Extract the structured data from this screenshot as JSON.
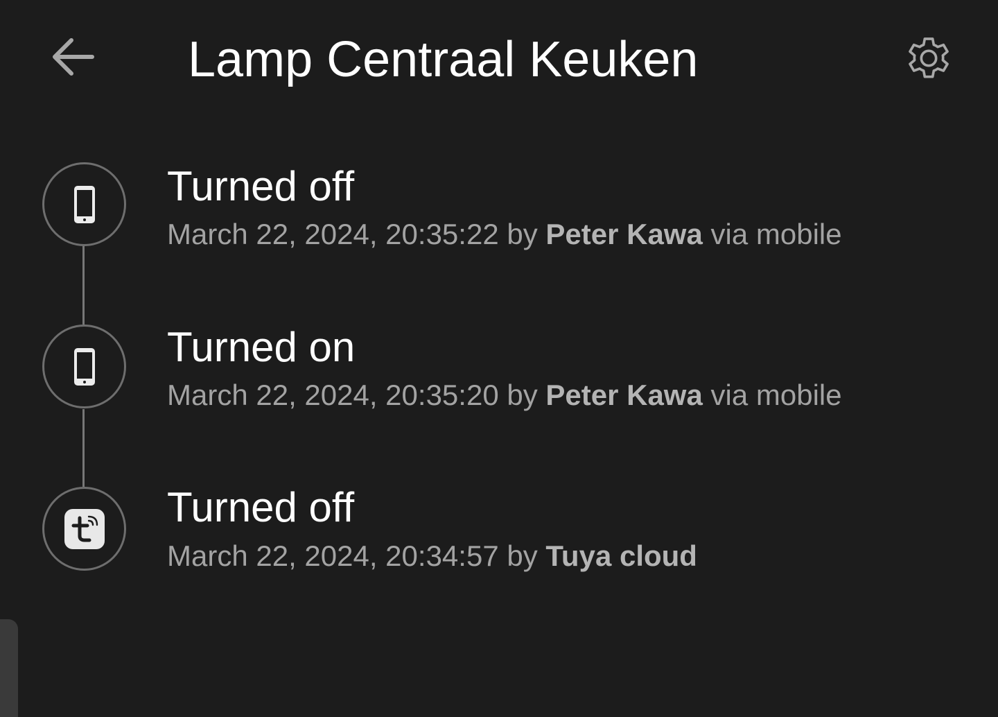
{
  "header": {
    "title": "Lamp Centraal Keuken",
    "back_icon": "arrow-left-icon",
    "settings_icon": "gear-icon"
  },
  "events": [
    {
      "title": "Turned off",
      "timestamp": "March 22, 2024, 20:35:22",
      "by_label": " by ",
      "actor": "Peter Kawa",
      "via": " via mobile",
      "source_icon": "mobile-phone-icon"
    },
    {
      "title": "Turned on",
      "timestamp": "March 22, 2024, 20:35:20",
      "by_label": " by ",
      "actor": "Peter Kawa",
      "via": " via mobile",
      "source_icon": "mobile-phone-icon"
    },
    {
      "title": "Turned off",
      "timestamp": "March 22, 2024, 20:34:57",
      "by_label": " by ",
      "actor": "Tuya cloud",
      "via": "",
      "source_icon": "tuya-app-icon"
    }
  ],
  "colors": {
    "background": "#1c1c1c",
    "title_text": "#ffffff",
    "meta_text": "#a3a3a3",
    "timeline_line": "#777777"
  }
}
